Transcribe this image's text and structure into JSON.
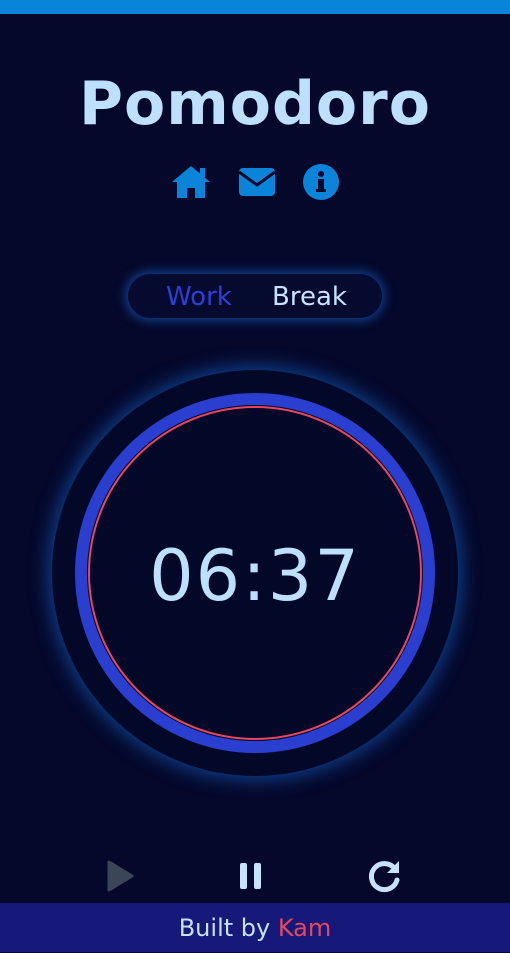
{
  "app": {
    "title": "Pomodoro"
  },
  "nav": {
    "icons": [
      "home-icon",
      "mail-icon",
      "info-icon"
    ]
  },
  "mode_toggle": {
    "options": [
      "Work",
      "Break"
    ],
    "selected": "Work"
  },
  "timer": {
    "display": "06:37"
  },
  "controls": {
    "icons": [
      "play-icon",
      "pause-icon",
      "restart-icon"
    ],
    "play_disabled": true
  },
  "footer": {
    "prefix": "Built by",
    "author": "Kam"
  },
  "colors": {
    "background": "#05082b",
    "accent_blue": "#0a84d8",
    "title_text": "#bde0ff",
    "ring_blue": "#2a3ecf",
    "ring_red": "#e8465e",
    "footer_bg": "#16187a"
  }
}
